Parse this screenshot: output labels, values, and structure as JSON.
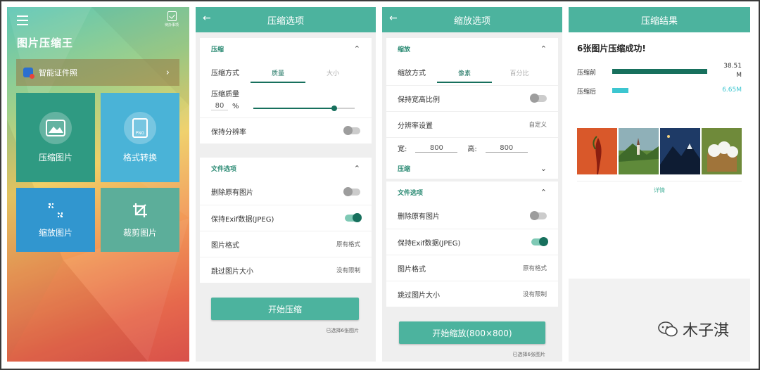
{
  "screen1": {
    "todo_label": "待办事项",
    "app_title": "图片压缩王",
    "id_card_label": "智能证件照",
    "tiles": [
      "压缩图片",
      "格式转换",
      "缩放图片",
      "裁剪图片"
    ],
    "png_label": "PNG"
  },
  "screen2": {
    "title": "压缩选项",
    "section_compress": "压缩",
    "method_label": "压缩方式",
    "tab_quality": "质量",
    "tab_size": "大小",
    "quality_label": "压缩质量",
    "quality_value": "80",
    "quality_unit": "%",
    "quality_slider": 0.8,
    "keep_resolution": "保持分辨率",
    "section_file": "文件选项",
    "delete_original": "删除原有图片",
    "keep_exif": "保持Exif数据(JPEG)",
    "image_format": "图片格式",
    "image_format_value": "原有格式",
    "skip_size": "跳过图片大小",
    "skip_size_value": "没有限制",
    "start_button": "开始压缩",
    "selected_note": "已选择6张图片"
  },
  "screen3": {
    "title": "缩放选项",
    "section_scale": "缩放",
    "method_label": "缩放方式",
    "tab_pixel": "像素",
    "tab_percent": "百分比",
    "keep_ratio": "保持宽高比例",
    "resolution_setting": "分辨率设置",
    "resolution_value": "自定义",
    "width_label": "宽:",
    "width_value": "800",
    "height_label": "高:",
    "height_value": "800",
    "section_compress": "压缩",
    "section_file": "文件选项",
    "delete_original": "删除原有图片",
    "keep_exif": "保持Exif数据(JPEG)",
    "image_format": "图片格式",
    "image_format_value": "原有格式",
    "skip_size": "跳过图片大小",
    "skip_size_value": "没有限制",
    "start_button": "开始缩放(800×800)",
    "selected_note": "已选择6张图片"
  },
  "screen4": {
    "title": "压缩结果",
    "success_text": "6张图片压缩成功!",
    "before_label": "压缩前",
    "before_value": "38.51 M",
    "after_label": "压缩后",
    "after_value": "6.65M",
    "details_link": "详情",
    "colors": {
      "before_bar": "#17705d",
      "after_bar": "#3cc6d0"
    }
  },
  "watermark": {
    "text": "木子淇"
  }
}
